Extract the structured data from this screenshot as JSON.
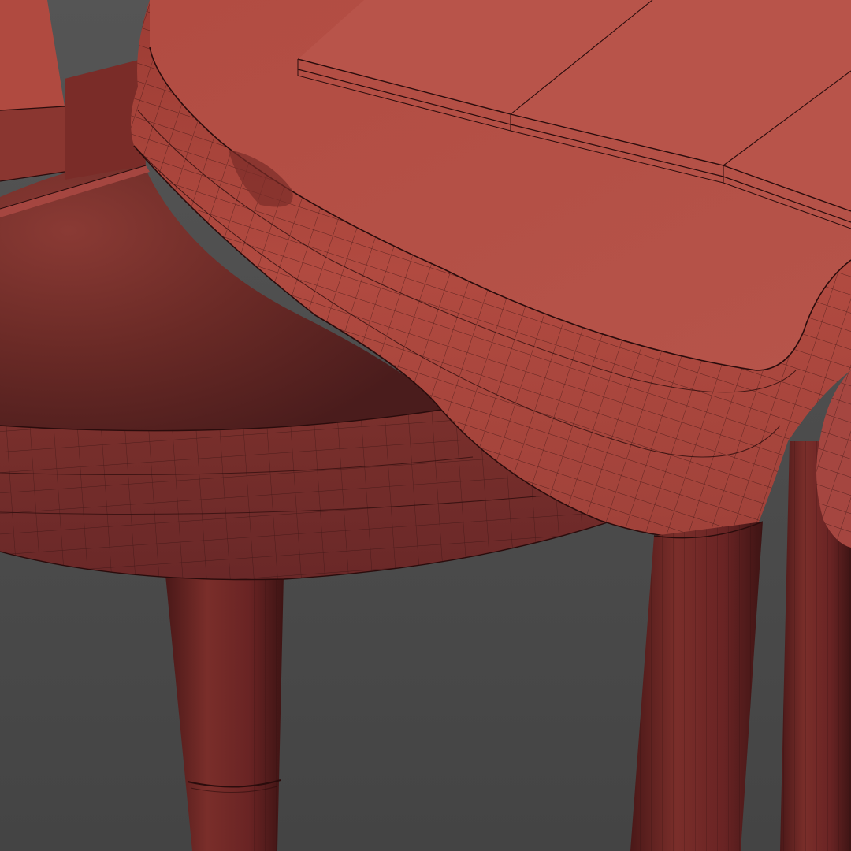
{
  "scene": {
    "subject": "",
    "colors": {
      "background": "#4a4a4a",
      "surface_light": "#b04a40",
      "surface_mid": "#9a3e36",
      "surface_dark": "#6a2622",
      "shadow": "#401618",
      "wire": "#2a0c0c"
    },
    "text": []
  }
}
